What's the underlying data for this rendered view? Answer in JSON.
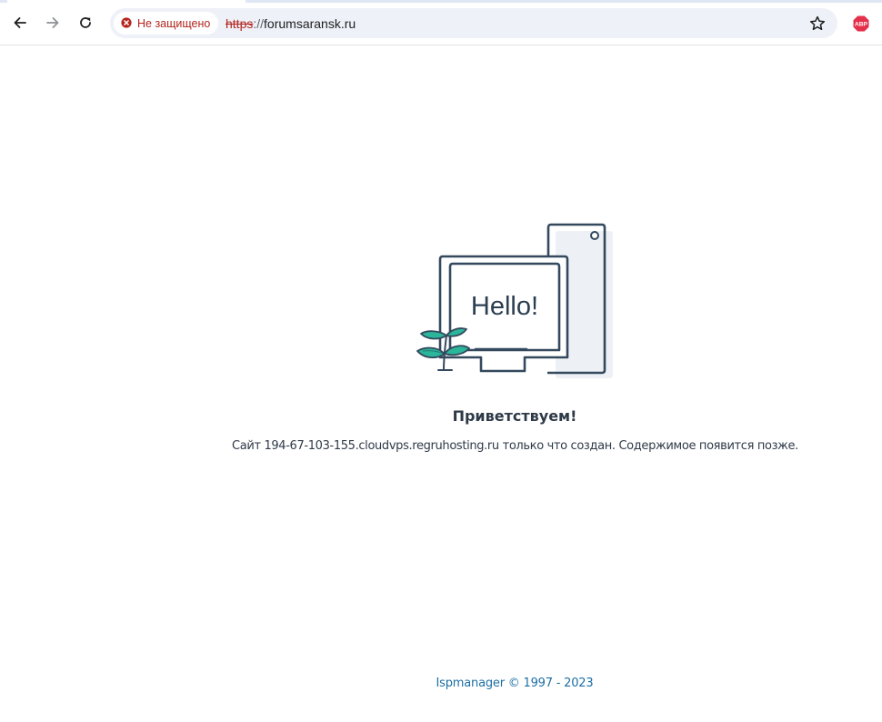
{
  "browser": {
    "security_label": "Не защищено",
    "url_scheme": "https",
    "url_separator": "://",
    "url_host": "forumsaransk.ru",
    "extension_label": "ABP",
    "icons": [
      "back-arrow-icon",
      "forward-arrow-icon",
      "reload-icon",
      "not-secure-icon",
      "bookmark-star-icon",
      "adblock-plus-icon"
    ]
  },
  "page": {
    "illustration_text": "Hello!",
    "welcome_heading": "Приветствуем!",
    "description": "Сайт 194-67-103-155.cloudvps.regruhosting.ru только что создан. Содержимое появится позже.",
    "footer_link": "Ispmanager © 1997 - 2023"
  },
  "colors": {
    "text_dark": "#2f3a48",
    "link": "#1d6fa5",
    "not_secure_red": "#b3261e",
    "leaf_green": "#2bb59a",
    "omnibox_bg": "#eef1f8"
  }
}
